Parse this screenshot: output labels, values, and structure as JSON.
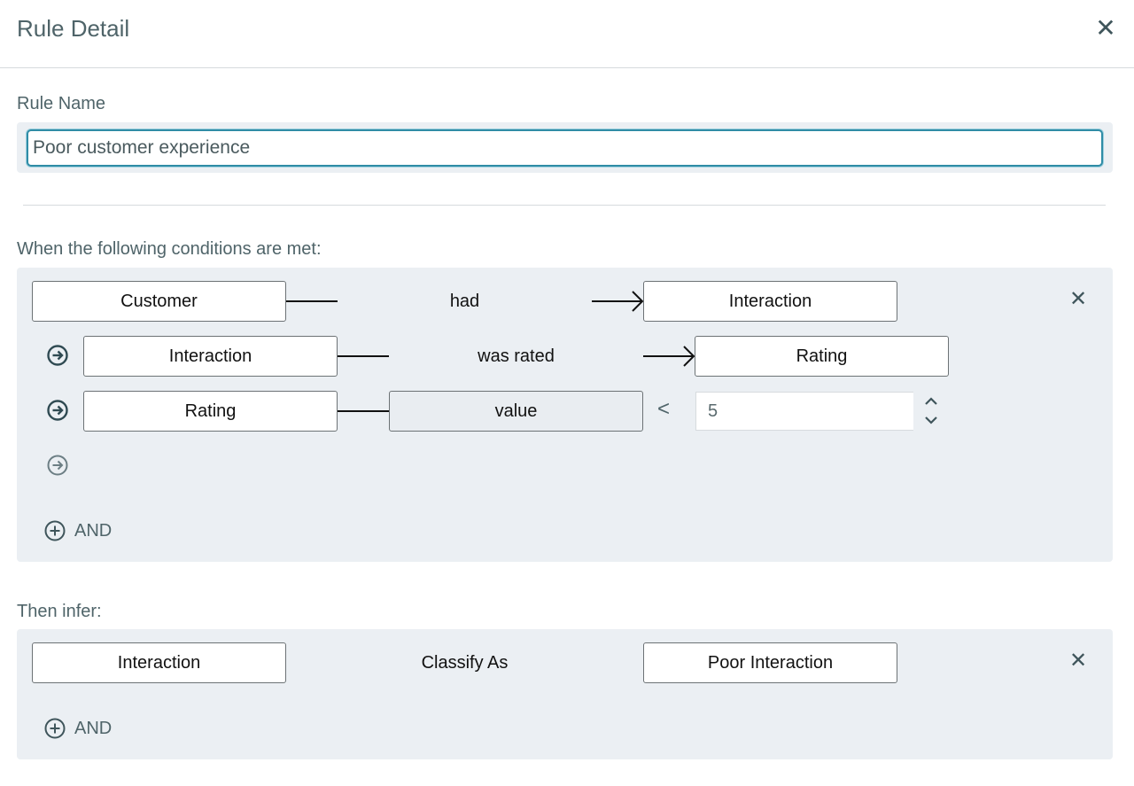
{
  "dialog": {
    "title": "Rule Detail",
    "close_icon": "close-icon"
  },
  "rule_name": {
    "label": "Rule Name",
    "value": "Poor customer experience"
  },
  "conditions": {
    "label": "When the following conditions are met:",
    "rows": [
      {
        "subject": "Customer",
        "relation": "had",
        "object": "Interaction"
      },
      {
        "subject": "Interaction",
        "relation": "was rated",
        "object": "Rating"
      },
      {
        "subject": "Rating",
        "property": "value",
        "operator": "<",
        "value": "5"
      }
    ],
    "add_label": "AND"
  },
  "inference": {
    "label": "Then infer:",
    "subject": "Interaction",
    "relation": "Classify As",
    "object": "Poor Interaction",
    "add_label": "AND"
  },
  "colors": {
    "accent": "#2f8ca6",
    "panel": "#ebeff3",
    "label": "#4f6469",
    "icon": "#2f4a52"
  }
}
